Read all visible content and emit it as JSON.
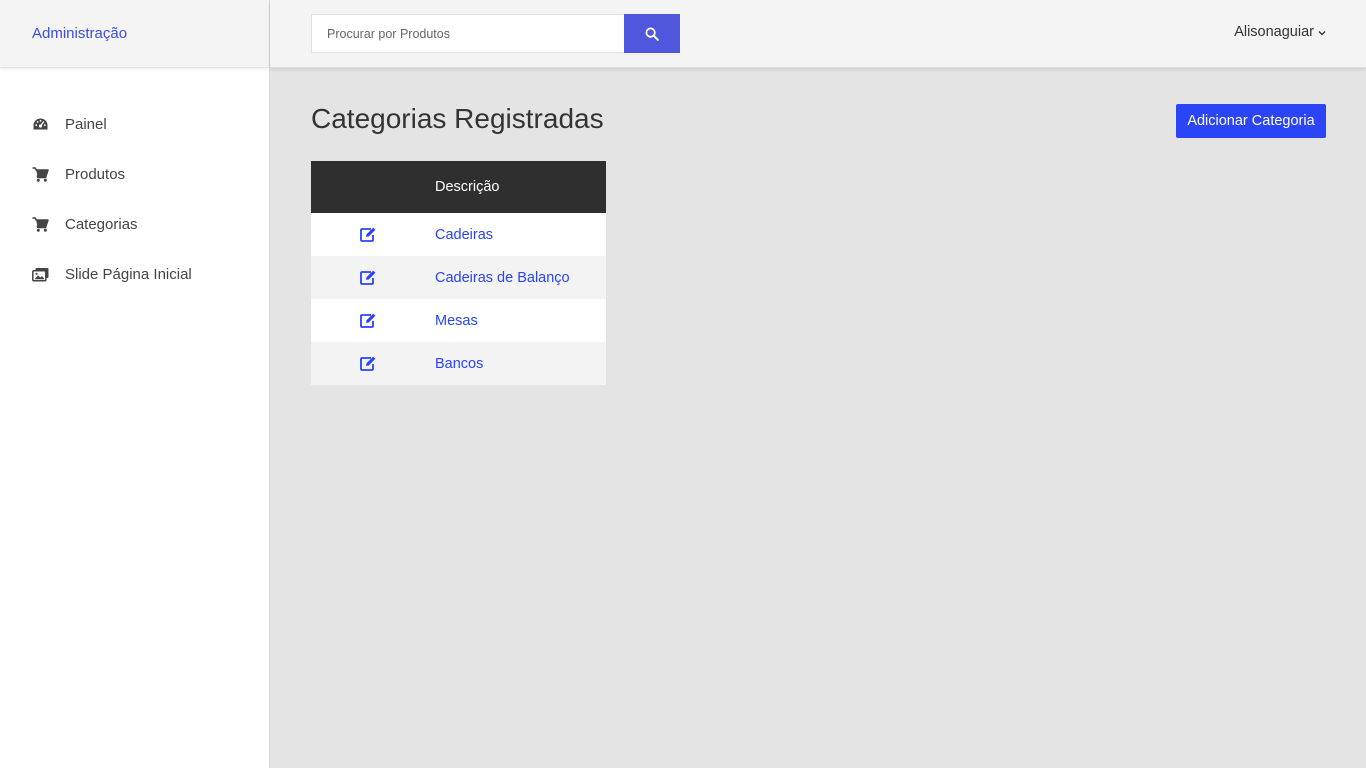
{
  "brand": {
    "label": "Administração"
  },
  "sidebar": {
    "items": [
      {
        "label": "Painel",
        "icon": "dashboard-icon"
      },
      {
        "label": "Produtos",
        "icon": "cart-icon"
      },
      {
        "label": "Categorias",
        "icon": "cart-icon"
      },
      {
        "label": "Slide Página Inicial",
        "icon": "images-icon"
      }
    ]
  },
  "header": {
    "search": {
      "placeholder": "Procurar por Produtos",
      "value": ""
    },
    "user": {
      "name": "Alisonaguiar"
    }
  },
  "main": {
    "title": "Categorias Registradas",
    "add_button": "Adicionar Categoria",
    "table": {
      "columns": [
        "",
        "Descrição"
      ],
      "rows": [
        {
          "description": "Cadeiras"
        },
        {
          "description": "Cadeiras de Balanço"
        },
        {
          "description": "Mesas"
        },
        {
          "description": "Bancos"
        }
      ]
    }
  },
  "colors": {
    "accent": "#2b44f5",
    "search_button": "#5057dd",
    "table_header": "#2f2f2f",
    "background": "#e4e4e4"
  }
}
